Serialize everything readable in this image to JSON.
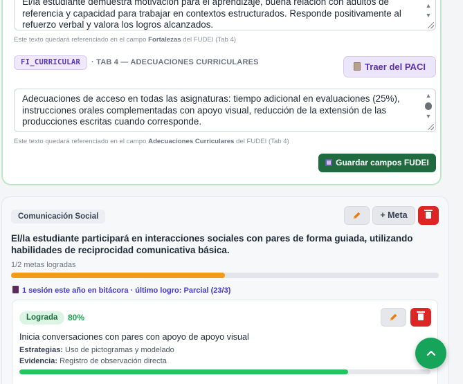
{
  "fudei_form": {
    "fortalezas_text": "El/la estudiante demuestra motivación para el aprendizaje, buena relación con adultos de referencia y capacidad para trabajar en contextos estructurados. Responde positivamente al refuerzo verbal y valora los logros alcanzados.",
    "fortalezas_hint_pre": "Este texto quedará referenciado en el campo ",
    "fortalezas_hint_field": "Fortalezas",
    "fortalezas_hint_post": " del FUDEI (Tab 4)",
    "tag_chip": "FI_CURRICULAR",
    "tab_label": "· TAB 4 — ADECUACIONES CURRICULARES",
    "paci_button": "Traer del PACI",
    "adecuaciones_text": "Adecuaciones de acceso en todas las asignaturas: tiempo adicional en evaluaciones (25%), instrucciones orales complementadas con apoyo visual, reducción de la extensión de las producciones escritas cuando corresponde.",
    "adecuaciones_hint_pre": "Este texto quedará referenciado en el campo ",
    "adecuaciones_hint_field": "Adecuaciones Curriculares",
    "adecuaciones_hint_post": " del FUDEI (Tab 4)",
    "save_button": "Guardar campos FUDEI"
  },
  "goal": {
    "area": "Comunicación Social",
    "meta_button": "+ Meta",
    "title": "El/la estudiante participará en interacciones sociales con pares de forma guiada, utilizando habilidades de reciprocidad comunicativa básica.",
    "progress_label": "1/2 metas logradas",
    "progress_fraction": 0.5,
    "session_line": "1 sesión este año en bitácora · último logro: Parcial (23/3)",
    "colors": {
      "progress": "#f29d17",
      "achieved": "#22c55e",
      "danger": "#dc2626",
      "edit": "#ea7a12"
    }
  },
  "subgoal": {
    "status": "Lograda",
    "percent_label": "80%",
    "percent": 0.8,
    "title": "Inicia conversaciones con pares con apoyo de apoyo visual",
    "strategies_label": "Estrategias:",
    "strategies_value": "Uso de pictogramas y modelado",
    "evidence_label": "Evidencia:",
    "evidence_value": "Registro de observación directa"
  },
  "icons": [
    "pencil-icon",
    "trash-icon",
    "clipboard-icon",
    "floppy-icon",
    "book-icon",
    "chevron-up-icon"
  ]
}
